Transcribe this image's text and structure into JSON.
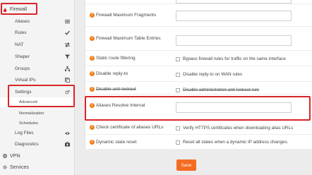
{
  "sidebar": {
    "firewall": "Firewall",
    "aliases": "Aliases",
    "rules": "Rules",
    "nat": "NAT",
    "shaper": "Shaper",
    "groups": "Groups",
    "virtual_ips": "Virtual IPs",
    "settings": "Settings",
    "advanced": "Advanced",
    "normalization": "Normalization",
    "schedules": "Schedules",
    "log_files": "Log Files",
    "diagnostics": "Diagnostics",
    "vpn": "VPN",
    "services": "Services"
  },
  "form": {
    "max_fragments": "Firewall Maximum Fragments",
    "max_table_entries": "Firewall Maximum Table Entries",
    "static_route_filtering": "Static route filtering",
    "static_route_filtering_opt": "Bypass firewall rules for traffic on the same interface",
    "disable_reply_to": "Disable reply-to",
    "disable_reply_to_opt": "Disable reply-to on WAN rules",
    "disable_anti_lockout": "Disable anti-lockout",
    "disable_anti_lockout_opt": "Disable administration anti-lockout rule",
    "aliases_resolve_interval": "Aliases Resolve Interval",
    "check_cert": "Check certificate of aliases URLs",
    "check_cert_opt": "Verify HTTPS certificates when downloading alias URLs",
    "dynamic_state_reset": "Dynamic state reset",
    "dynamic_state_reset_opt": "Reset all states when a dynamic IP address changes.",
    "save": "Save"
  },
  "colors": {
    "accent": "#f36c21",
    "info_icon": "#ef7e1c",
    "highlight_box": "#d9242b"
  }
}
